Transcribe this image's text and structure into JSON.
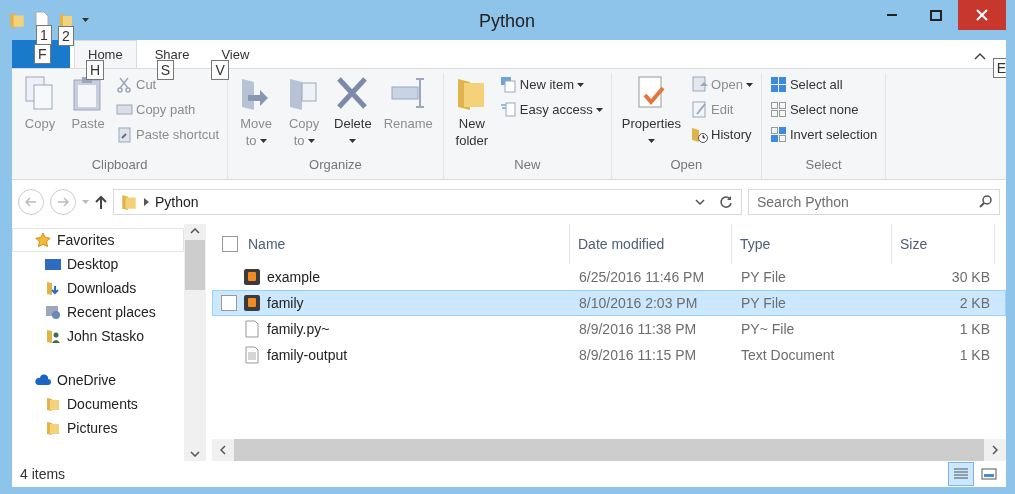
{
  "window": {
    "title": "Python"
  },
  "quick_access": {
    "keytips": [
      "1",
      "2"
    ]
  },
  "ribbon_tabs": [
    {
      "kind": "file",
      "keytip": "F",
      "selected": false
    },
    {
      "kind": "tab",
      "label": "Home",
      "keytip": "H",
      "selected": true
    },
    {
      "kind": "tab",
      "label": "Share",
      "keytip": "S",
      "selected": false
    },
    {
      "kind": "tab",
      "label": "View",
      "keytip": "V",
      "selected": false
    }
  ],
  "help_keytip": "E",
  "ribbon_groups": [
    {
      "label": "Clipboard",
      "items": [
        {
          "kind": "large",
          "label": "Copy",
          "disabled": true
        },
        {
          "kind": "large",
          "label": "Paste",
          "disabled": true
        },
        {
          "kind": "stack",
          "items": [
            {
              "label": "Cut",
              "disabled": true
            },
            {
              "label": "Copy path",
              "disabled": true
            },
            {
              "label": "Paste shortcut",
              "disabled": true
            }
          ]
        }
      ]
    },
    {
      "label": "Organize",
      "items": [
        {
          "kind": "large",
          "label": "Move to",
          "dropdown": true,
          "disabled": true
        },
        {
          "kind": "large",
          "label": "Copy to",
          "dropdown": true,
          "disabled": true
        },
        {
          "kind": "large",
          "label": "Delete",
          "dropdown": true,
          "disabled": false
        },
        {
          "kind": "large",
          "label": "Rename",
          "disabled": true
        }
      ]
    },
    {
      "label": "New",
      "items": [
        {
          "kind": "large",
          "label": "New folder",
          "disabled": false
        },
        {
          "kind": "stack",
          "items": [
            {
              "label": "New item",
              "dropdown": true,
              "disabled": false
            },
            {
              "label": "Easy access",
              "dropdown": true,
              "disabled": false
            }
          ]
        }
      ]
    },
    {
      "label": "Open",
      "items": [
        {
          "kind": "large",
          "label": "Properties",
          "dropdown": true,
          "disabled": false
        },
        {
          "kind": "stack",
          "items": [
            {
              "label": "Open",
              "dropdown": true,
              "disabled": true
            },
            {
              "label": "Edit",
              "disabled": true
            },
            {
              "label": "History",
              "disabled": false
            }
          ]
        }
      ]
    },
    {
      "label": "Select",
      "items": [
        {
          "kind": "stack",
          "items": [
            {
              "label": "Select all",
              "disabled": false
            },
            {
              "label": "Select none",
              "disabled": false
            },
            {
              "label": "Invert selection",
              "disabled": false
            }
          ]
        }
      ]
    }
  ],
  "address_bar": {
    "path": "Python"
  },
  "search": {
    "placeholder": "Search Python"
  },
  "navigation_pane": [
    {
      "label": "Favorites",
      "selected": true,
      "children": [
        {
          "label": "Desktop",
          "selected": false
        },
        {
          "label": "Downloads",
          "selected": false
        },
        {
          "label": "Recent places",
          "selected": false
        },
        {
          "label": "John Stasko",
          "selected": false
        }
      ]
    },
    {
      "label": "OneDrive",
      "selected": false,
      "children": [
        {
          "label": "Documents",
          "selected": false
        },
        {
          "label": "Pictures",
          "selected": false
        }
      ]
    }
  ],
  "table": {
    "select_all_checked": false,
    "columns": [
      "Name",
      "Date modified",
      "Type",
      "Size"
    ],
    "rows": [
      {
        "kind": "sublime",
        "name": "example",
        "date": "6/25/2016 11:46 PM",
        "type": "PY File",
        "size": "30 KB",
        "selected": false
      },
      {
        "kind": "sublime",
        "name": "family",
        "date": "8/10/2016 2:03 PM",
        "type": "PY File",
        "size": "2 KB",
        "selected": true
      },
      {
        "kind": "blank",
        "name": "family.py~",
        "date": "8/9/2016 11:38 PM",
        "type": "PY~ File",
        "size": "1 KB",
        "selected": false
      },
      {
        "kind": "text",
        "name": "family-output",
        "date": "8/9/2016 11:15 PM",
        "type": "Text Document",
        "size": "1 KB",
        "selected": false
      }
    ]
  },
  "status_bar": {
    "count": "4 items"
  },
  "view_buttons": [
    {
      "kind": "details",
      "selected": true
    },
    {
      "kind": "thumbnails",
      "selected": false
    }
  ]
}
